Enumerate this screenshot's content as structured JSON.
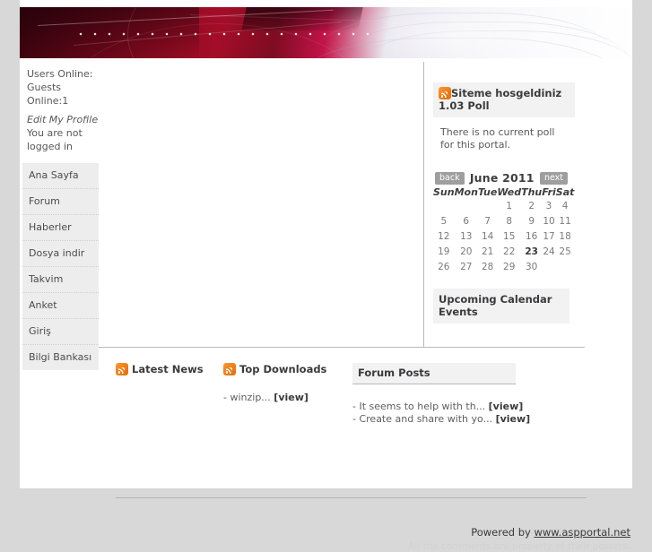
{
  "sidebar": {
    "users_online_label": "Users Online:",
    "guests_label": "Guests",
    "online_count": "Online:1",
    "edit_profile": "Edit My Profile",
    "login_status": "You are not logged in",
    "menu": [
      {
        "label": "Ana Sayfa"
      },
      {
        "label": "Forum"
      },
      {
        "label": "Haberler"
      },
      {
        "label": "Dosya indir"
      },
      {
        "label": "Takvim"
      },
      {
        "label": "Anket"
      },
      {
        "label": "Giriş"
      },
      {
        "label": "Bilgi Bankası"
      }
    ]
  },
  "poll": {
    "icon": "rss-icon",
    "title": "Siteme hosgeldiniz 1.03 Poll",
    "body": "There is no current poll for this portal."
  },
  "calendar": {
    "back_label": "back",
    "next_label": "next",
    "title": "June 2011",
    "weekdays": [
      "Sun",
      "Mon",
      "Tue",
      "Wed",
      "Thu",
      "Fri",
      "Sat"
    ],
    "weeks": [
      [
        "",
        "",
        "",
        "1",
        "2",
        "3",
        "4"
      ],
      [
        "5",
        "6",
        "7",
        "8",
        "9",
        "10",
        "11"
      ],
      [
        "12",
        "13",
        "14",
        "15",
        "16",
        "17",
        "18"
      ],
      [
        "19",
        "20",
        "21",
        "22",
        "23",
        "24",
        "25"
      ],
      [
        "26",
        "27",
        "28",
        "29",
        "30",
        "",
        ""
      ]
    ],
    "today": "23",
    "upcoming_title": "Upcoming Calendar Events"
  },
  "bottom": {
    "latest_news": {
      "icon": "rss-icon",
      "title": "Latest News",
      "items": []
    },
    "top_downloads": {
      "icon": "rss-icon",
      "title": "Top Downloads",
      "items": [
        {
          "text": "- winzip...",
          "link": "[view]"
        }
      ]
    },
    "forum_posts": {
      "title": "Forum Posts",
      "items": [
        {
          "text": "- It seems to help with th...",
          "link": "[view]"
        },
        {
          "text": "- Create and share with yo...",
          "link": "[view]"
        }
      ]
    }
  },
  "footer": {
    "powered_by": "Powered by ",
    "link": "www.aspportal.net",
    "disclaimer": "All the comments are property of their posters."
  },
  "colors": {
    "accent_rss": "#f07d17",
    "banner_red": "#8b0a20",
    "banner_magenta": "#c21348",
    "menu_bg": "#ededed",
    "panel_bg": "#f2f2f2",
    "page_bg": "#d8d8d8"
  }
}
